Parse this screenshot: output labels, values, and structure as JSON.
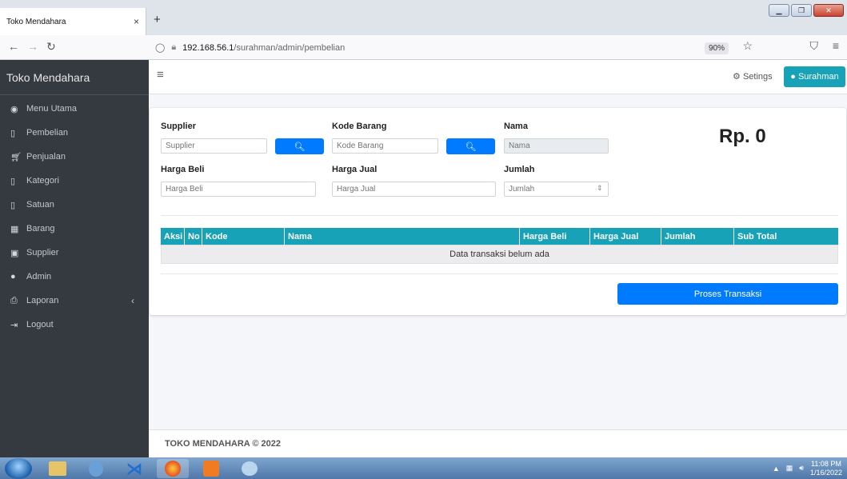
{
  "browser": {
    "tab_title": "Toko Mendahara",
    "tab_close": "×",
    "new_tab": "+",
    "url_host": "192.168.56.1",
    "url_path": "/surahman/admin/pembelian",
    "zoom": "90%"
  },
  "sidebar": {
    "brand": "Toko Mendahara",
    "items": [
      {
        "label": "Menu Utama",
        "icon": "dashboard-icon"
      },
      {
        "label": "Pembelian",
        "icon": "bookmark-icon"
      },
      {
        "label": "Penjualan",
        "icon": "cart-icon"
      },
      {
        "label": "Kategori",
        "icon": "file-icon"
      },
      {
        "label": "Satuan",
        "icon": "file-icon"
      },
      {
        "label": "Barang",
        "icon": "box-icon"
      },
      {
        "label": "Supplier",
        "icon": "id-card-icon"
      },
      {
        "label": "Admin",
        "icon": "user-icon"
      },
      {
        "label": "Laporan",
        "icon": "print-icon"
      },
      {
        "label": "Logout",
        "icon": "sign-out-icon"
      }
    ]
  },
  "header": {
    "settings_label": "Setings",
    "user_label": "Surahman"
  },
  "form": {
    "supplier_label": "Supplier",
    "supplier_placeholder": "Supplier",
    "kode_label": "Kode Barang",
    "kode_placeholder": "Kode Barang",
    "nama_label": "Nama",
    "nama_placeholder": "Nama",
    "harga_beli_label": "Harga Beli",
    "harga_beli_placeholder": "Harga Beli",
    "harga_jual_label": "Harga Jual",
    "harga_jual_placeholder": "Harga Jual",
    "jumlah_label": "Jumlah",
    "jumlah_placeholder": "Jumlah",
    "total": "Rp. 0"
  },
  "table": {
    "columns": [
      "Aksi",
      "No",
      "Kode",
      "Nama",
      "Harga Beli",
      "Harga Jual",
      "Jumlah",
      "Sub Total"
    ],
    "empty_message": "Data transaksi belum ada"
  },
  "actions": {
    "proses_label": "Proses Transaksi"
  },
  "footer": {
    "text": "TOKO MENDAHARA © 2022"
  },
  "taskbar": {
    "time": "11:08 PM",
    "date": "1/16/2022"
  },
  "colors": {
    "sidebar_bg": "#343a40",
    "accent_info": "#17a2b8",
    "primary": "#007bff"
  }
}
